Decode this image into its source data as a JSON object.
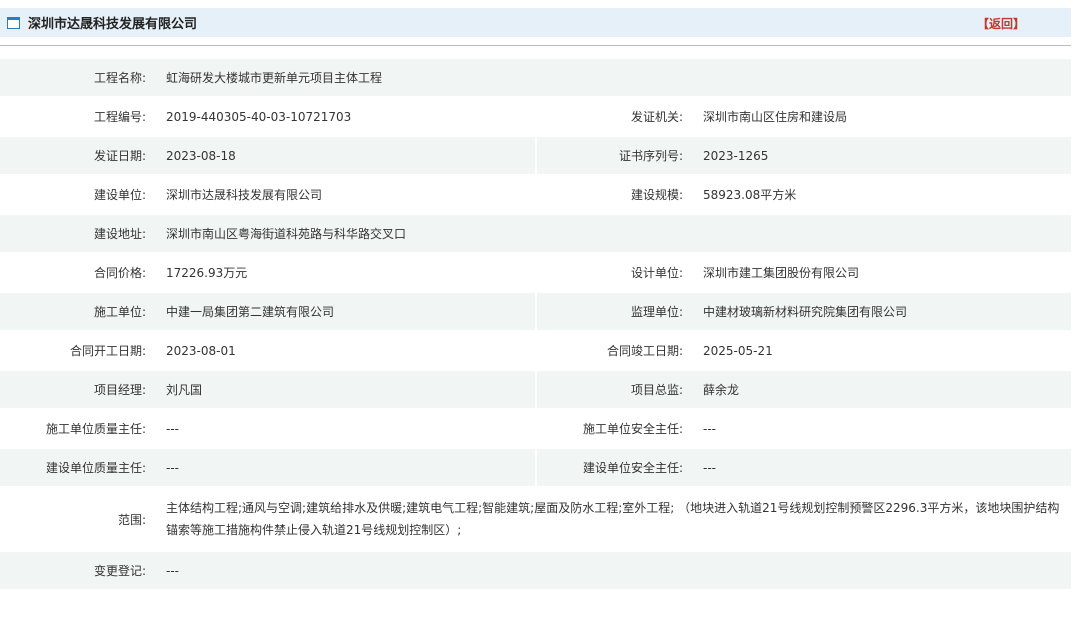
{
  "header": {
    "title": "深圳市达晟科技发展有限公司",
    "back_label": "【返回】"
  },
  "fields": {
    "project_name": {
      "label": "工程名称:",
      "value": "虹海研发大楼城市更新单元项目主体工程"
    },
    "project_no": {
      "label": "工程编号:",
      "value": "2019-440305-40-03-10721703"
    },
    "issuer": {
      "label": "发证机关:",
      "value": "深圳市南山区住房和建设局"
    },
    "issue_date": {
      "label": "发证日期:",
      "value": "2023-08-18"
    },
    "cert_serial": {
      "label": "证书序列号:",
      "value": "2023-1265"
    },
    "builder": {
      "label": "建设单位:",
      "value": "深圳市达晟科技发展有限公司"
    },
    "scale": {
      "label": "建设规模:",
      "value": "58923.08平方米"
    },
    "address": {
      "label": "建设地址:",
      "value": "深圳市南山区粤海街道科苑路与科华路交叉口"
    },
    "contract_price": {
      "label": "合同价格:",
      "value": "17226.93万元"
    },
    "designer": {
      "label": "设计单位:",
      "value": "深圳市建工集团股份有限公司"
    },
    "contractor": {
      "label": "施工单位:",
      "value": "中建一局集团第二建筑有限公司"
    },
    "supervisor": {
      "label": "监理单位:",
      "value": "中建材玻璃新材料研究院集团有限公司"
    },
    "start_date": {
      "label": "合同开工日期:",
      "value": "2023-08-01"
    },
    "end_date": {
      "label": "合同竣工日期:",
      "value": "2025-05-21"
    },
    "pm": {
      "label": "项目经理:",
      "value": "刘凡国"
    },
    "chief_supervisor": {
      "label": "项目总监:",
      "value": "薛余龙"
    },
    "contractor_quality": {
      "label": "施工单位质量主任:",
      "value": "---"
    },
    "contractor_safety": {
      "label": "施工单位安全主任:",
      "value": "---"
    },
    "builder_quality": {
      "label": "建设单位质量主任:",
      "value": "---"
    },
    "builder_safety": {
      "label": "建设单位安全主任:",
      "value": "---"
    },
    "scope": {
      "label": "范围:",
      "value": "主体结构工程;通风与空调;建筑给排水及供暖;建筑电气工程;智能建筑;屋面及防水工程;室外工程; （地块进入轨道21号线规划控制预警区2296.3平方米，该地块围护结构锚索等施工措施构件禁止侵入轨道21号线规划控制区）;"
    },
    "change_record": {
      "label": "变更登记:",
      "value": "---"
    }
  },
  "colors": {
    "header_bg": "#e6f0f8",
    "row_shade": "#f1f5f3",
    "back_link": "#c0392b",
    "icon_border": "#2b7bc0"
  }
}
